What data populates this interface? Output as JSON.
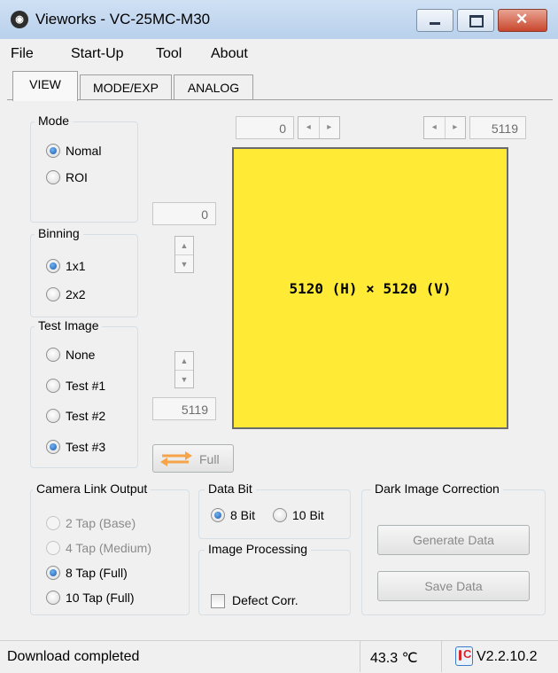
{
  "window": {
    "title": "Vieworks - VC-25MC-M30"
  },
  "menu": [
    "File",
    "Start-Up",
    "Tool",
    "About"
  ],
  "tabs": [
    "VIEW",
    "MODE/EXP",
    "ANALOG"
  ],
  "mode": {
    "title": "Mode",
    "options": [
      "Nomal",
      "ROI"
    ],
    "selected": "Nomal"
  },
  "binning": {
    "title": "Binning",
    "options": [
      "1x1",
      "2x2"
    ],
    "selected": "1x1"
  },
  "test_image": {
    "title": "Test Image",
    "options": [
      "None",
      "Test #1",
      "Test #2",
      "Test #3"
    ],
    "selected": "Test #3"
  },
  "roi": {
    "h_start": "0",
    "h_end": "5119",
    "v_start": "0",
    "v_end": "5119",
    "size_label": "5120 (H) × 5120 (V)",
    "full_label": "Full",
    "preview_color": "#ffeb36"
  },
  "camera_link": {
    "title": "Camera Link Output",
    "options": [
      "2 Tap (Base)",
      "4 Tap (Medium)",
      "8 Tap (Full)",
      "10 Tap (Full)"
    ],
    "selected": "8 Tap (Full)"
  },
  "data_bit": {
    "title": "Data Bit",
    "options": [
      "8 Bit",
      "10 Bit"
    ],
    "selected": "8 Bit"
  },
  "image_processing": {
    "title": "Image Processing",
    "defect_corr_label": "Defect Corr.",
    "defect_corr_checked": false
  },
  "dark_image": {
    "title": "Dark Image Correction",
    "generate_label": "Generate Data",
    "save_label": "Save Data"
  },
  "status": {
    "message": "Download completed",
    "temperature": "43.3 ℃",
    "version": "V2.2.10.2"
  }
}
